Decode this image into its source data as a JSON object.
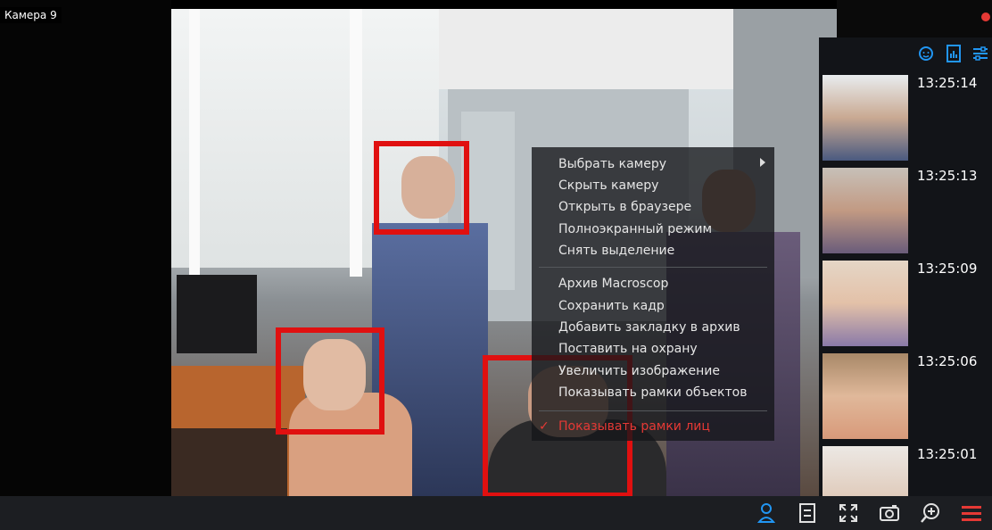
{
  "camera": {
    "title": "Камера 9"
  },
  "context_menu": {
    "groups": [
      [
        "Выбрать камеру",
        "Скрыть камеру",
        "Открыть в браузере",
        "Полноэкранный режим",
        "Снять выделение"
      ],
      [
        "Архив Macroscop",
        "Сохранить кадр",
        "Добавить закладку в архив",
        "Поставить на охрану",
        "Увеличить изображение",
        "Показывать рамки объектов"
      ],
      [
        "Показывать рамки лиц"
      ]
    ],
    "checked_item": "Показывать рамки лиц"
  },
  "face_panel": {
    "toolbar_icons": [
      "face-search-icon",
      "report-icon",
      "filter-settings-icon"
    ],
    "faces": [
      {
        "time": "13:25:14"
      },
      {
        "time": "13:25:13"
      },
      {
        "time": "13:25:09"
      },
      {
        "time": "13:25:06"
      },
      {
        "time": "13:25:01"
      }
    ]
  },
  "bottom_toolbar": {
    "buttons": [
      "person-icon",
      "archive-icon",
      "fullscreen-icon",
      "snapshot-icon",
      "zoom-icon",
      "menu-icon"
    ],
    "active_color": "#2196f3",
    "menu_color": "#e53935"
  },
  "colors": {
    "face_box": "#e01010",
    "accent": "#2196f3",
    "record": "#e53935"
  }
}
